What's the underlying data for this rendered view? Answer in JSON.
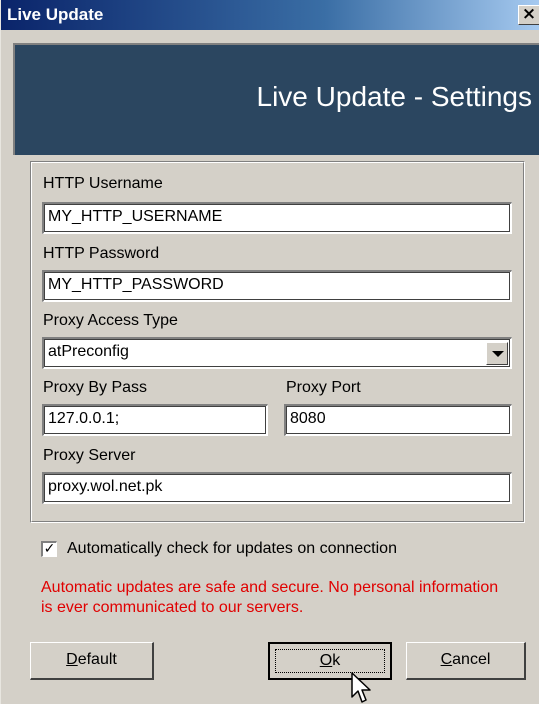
{
  "window": {
    "title": "Live Update",
    "close_glyph": "×"
  },
  "banner": {
    "title": "Live Update - Settings"
  },
  "form": {
    "http_username_label": "HTTP Username",
    "http_username_value": "MY_HTTP_USERNAME",
    "http_password_label": "HTTP Password",
    "http_password_value": "MY_HTTP_PASSWORD",
    "proxy_access_type_label": "Proxy Access Type",
    "proxy_access_type_value": "atPreconfig",
    "proxy_bypass_label": "Proxy By Pass",
    "proxy_bypass_value": "127.0.0.1;",
    "proxy_port_label": "Proxy Port",
    "proxy_port_value": "8080",
    "proxy_server_label": "Proxy Server",
    "proxy_server_value": "proxy.wol.net.pk"
  },
  "auto_check": {
    "checked": true,
    "check_glyph": "✓",
    "label": "Automatically check for updates on connection"
  },
  "notice": "Automatic updates are safe and secure. No personal information is ever communicated to our servers.",
  "buttons": {
    "default_mnemonic": "D",
    "default_rest": "efault",
    "ok_mnemonic": "O",
    "ok_rest": "k",
    "cancel_mnemonic": "C",
    "cancel_rest": "ancel"
  },
  "colors": {
    "title_bar": "#0a246a",
    "banner": "#2b4660",
    "face": "#d4d0c8",
    "notice_text": "#e00000"
  },
  "icons": [
    "close-icon",
    "dropdown-arrow-icon",
    "checkmark-icon",
    "mouse-pointer-icon"
  ]
}
